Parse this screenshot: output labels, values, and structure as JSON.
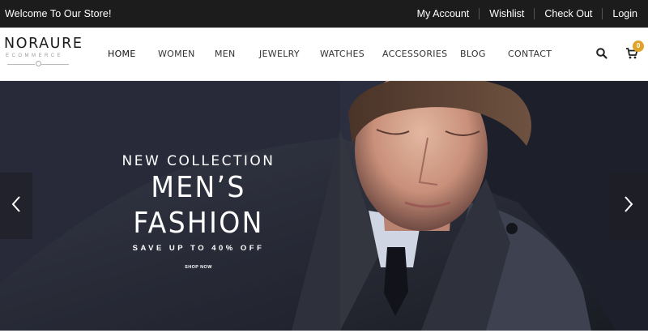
{
  "topbar": {
    "welcome": "Welcome To Our Store!",
    "links": [
      "My Account",
      "Wishlist",
      "Check Out",
      "Login"
    ]
  },
  "logo": {
    "name": "NORAURE",
    "tagline": "ECOMMERCE"
  },
  "nav": {
    "items": [
      "HOME",
      "WOMEN",
      "MEN",
      "JEWELRY",
      "WATCHES",
      "ACCESSORIES",
      "BLOG",
      "CONTACT"
    ],
    "active": "HOME"
  },
  "header_icons": {
    "search": "search-icon",
    "cart": "cart-icon",
    "cart_count": "0"
  },
  "hero": {
    "subtitle": "NEW COLLECTION",
    "title": "MEN’S FASHION",
    "offer": "SAVE UP TO 40% OFF",
    "cta": "SHOP NOW",
    "prev_icon": "chevron-left-icon",
    "next_icon": "chevron-right-icon"
  },
  "colors": {
    "topbar_bg": "#1c1c1c",
    "badge": "#e0a32a",
    "hero_bg": "#2c2e3e"
  }
}
